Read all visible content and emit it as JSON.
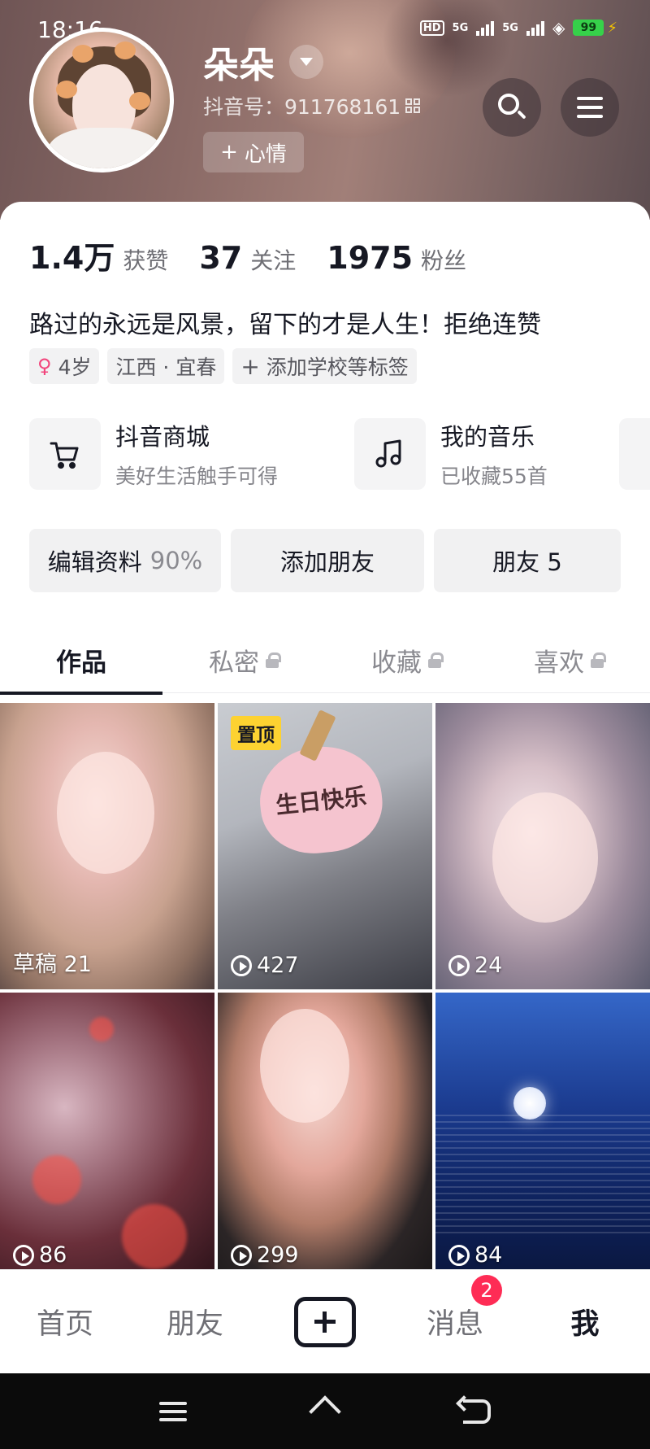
{
  "status_bar": {
    "time": "18:16",
    "hd_label": "HD",
    "network1": "5G",
    "network2": "5G",
    "battery": "99"
  },
  "profile": {
    "username": "朵朵",
    "douyin_id": "抖音号：911768161",
    "mood_button": "心情",
    "mood_prefix": "+",
    "stats": [
      {
        "value": "1.4万",
        "label": "获赞"
      },
      {
        "value": "37",
        "label": "关注"
      },
      {
        "value": "1975",
        "label": "粉丝"
      }
    ],
    "bio": "路过的永远是风景，留下的才是人生！拒绝连赞",
    "tags": {
      "age": "4岁",
      "location": "江西 · 宜春",
      "add_school": "添加学校等标签"
    }
  },
  "services": [
    {
      "title": "抖音商城",
      "subtitle": "美好生活触手可得",
      "icon": "cart-icon"
    },
    {
      "title": "我的音乐",
      "subtitle": "已收藏55首",
      "icon": "music-note-icon"
    }
  ],
  "actions": {
    "edit_profile": "编辑资料",
    "edit_progress": "90%",
    "add_friend": "添加朋友",
    "friends": "朋友 5"
  },
  "tabs": [
    {
      "label": "作品",
      "active": true,
      "locked": false
    },
    {
      "label": "私密",
      "active": false,
      "locked": true
    },
    {
      "label": "收藏",
      "active": false,
      "locked": true
    },
    {
      "label": "喜欢",
      "active": false,
      "locked": true
    }
  ],
  "videos": [
    {
      "label": "草稿 21",
      "type": "draft"
    },
    {
      "label": "427",
      "type": "play",
      "pinned": "置顶",
      "overlay_text": "生日快乐"
    },
    {
      "label": "24",
      "type": "play"
    },
    {
      "label": "86",
      "type": "play"
    },
    {
      "label": "299",
      "type": "play"
    },
    {
      "label": "84",
      "type": "play"
    }
  ],
  "bottom_nav": {
    "home": "首页",
    "friends": "朋友",
    "messages": "消息",
    "messages_badge": "2",
    "me": "我"
  },
  "colors": {
    "accent": "#fe2c55",
    "pin_badge": "#fdd231",
    "text_primary": "#161823"
  }
}
